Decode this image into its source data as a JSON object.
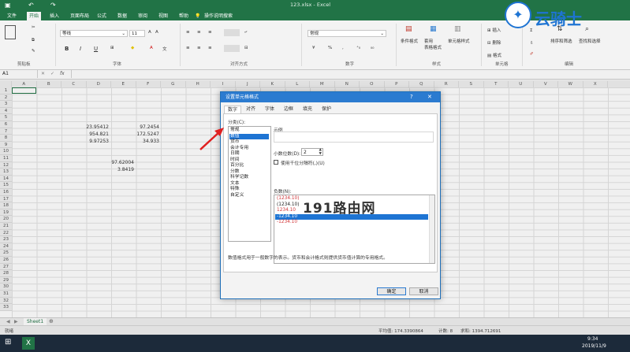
{
  "titlebar": {
    "filename": "123.xlsx  -  Excel",
    "undo_icon": "undo-icon",
    "redo_icon": "redo-icon",
    "save_icon": "save-icon"
  },
  "tabs": [
    "文件",
    "开始",
    "插入",
    "页面布局",
    "公式",
    "数据",
    "审阅",
    "视图",
    "帮助",
    "操作说明搜索"
  ],
  "ribbon": {
    "clipboard": {
      "label": "剪贴板"
    },
    "font": {
      "label": "字体",
      "name": "等线",
      "size": "11",
      "bold": "B",
      "italic": "I",
      "underline": "U"
    },
    "alignment": {
      "label": "对齐方式"
    },
    "number": {
      "label": "数字",
      "format": "常规",
      "percent": "%",
      "comma": ","
    },
    "styles": {
      "label": "样式",
      "conditional": "条件格式",
      "table": "套用\n表格格式",
      "cell": "单元格样式"
    },
    "cells": {
      "label": "单元格",
      "insert": "插入",
      "delete": "删除",
      "format": "格式"
    },
    "editing": {
      "label": "编辑",
      "sort": "排序和筛选",
      "find": "查找和选择"
    }
  },
  "formula_bar": {
    "name_box": "A1",
    "fx": "fx"
  },
  "columns": [
    "A",
    "B",
    "C",
    "D",
    "E",
    "F",
    "G",
    "H",
    "I",
    "J",
    "K",
    "L",
    "M",
    "N",
    "O",
    "P",
    "Q",
    "R",
    "S",
    "T",
    "U",
    "V",
    "W",
    "X"
  ],
  "rows": [
    "1",
    "2",
    "3",
    "4",
    "5",
    "6",
    "7",
    "8",
    "9",
    "10",
    "11",
    "12",
    "13",
    "14",
    "15",
    "16",
    "17",
    "18",
    "19",
    "20",
    "21",
    "22",
    "23",
    "24",
    "25",
    "26",
    "27",
    "28",
    "29",
    "30",
    "31",
    "32",
    "33"
  ],
  "cells": [
    {
      "v": "23.95412"
    },
    {
      "v": "97.2454"
    },
    {
      "v": "954.821"
    },
    {
      "v": "172.5247"
    },
    {
      "v": "9.97253"
    },
    {
      "v": "34.933"
    },
    {
      "v": "97.62004"
    },
    {
      "v": "3.8419"
    }
  ],
  "watermark": {
    "brand": "云骑士",
    "mid": "191路由网"
  },
  "dialog": {
    "title": "设置单元格格式",
    "help": "?",
    "close": "✕",
    "tabs": [
      "数字",
      "对齐",
      "字体",
      "边框",
      "填充",
      "保护"
    ],
    "category_label": "分类(C):",
    "categories": [
      "常规",
      "数值",
      "货币",
      "会计专用",
      "日期",
      "时间",
      "百分比",
      "分数",
      "科学记数",
      "文本",
      "特殊",
      "自定义"
    ],
    "selected_category": 1,
    "sample_label": "示例",
    "decimal_label": "小数位数(D):",
    "decimal_value": "2",
    "thousands_label": "使用千位分隔符(,)(U)",
    "negative_label": "负数(N):",
    "negative_options": [
      "(1234.10)",
      "(1234.10)",
      "1234.10",
      "-1234.10",
      "-1234.10"
    ],
    "negative_colors": [
      "#d13438",
      "#222222",
      "#d13438",
      "#ffffff",
      "#d13438"
    ],
    "selected_negative": 3,
    "description": "数值格式用于一般数字的表示。货币和会计格式则提供货币值计算的专用格式。",
    "ok": "确定",
    "cancel": "取消"
  },
  "sheet_tab": "Sheet1",
  "status": {
    "ready": "就绪",
    "average": "平均值: 174.3390864",
    "count": "计数: 8",
    "sum": "求和: 1394.712691"
  },
  "taskbar": {
    "time": "9:34",
    "date": "2019/11/9"
  },
  "colors": {
    "excel_green": "#217346",
    "dialog_blue": "#2b7bd0",
    "selection_blue": "#1e74d3",
    "arrow_red": "#e02020"
  }
}
